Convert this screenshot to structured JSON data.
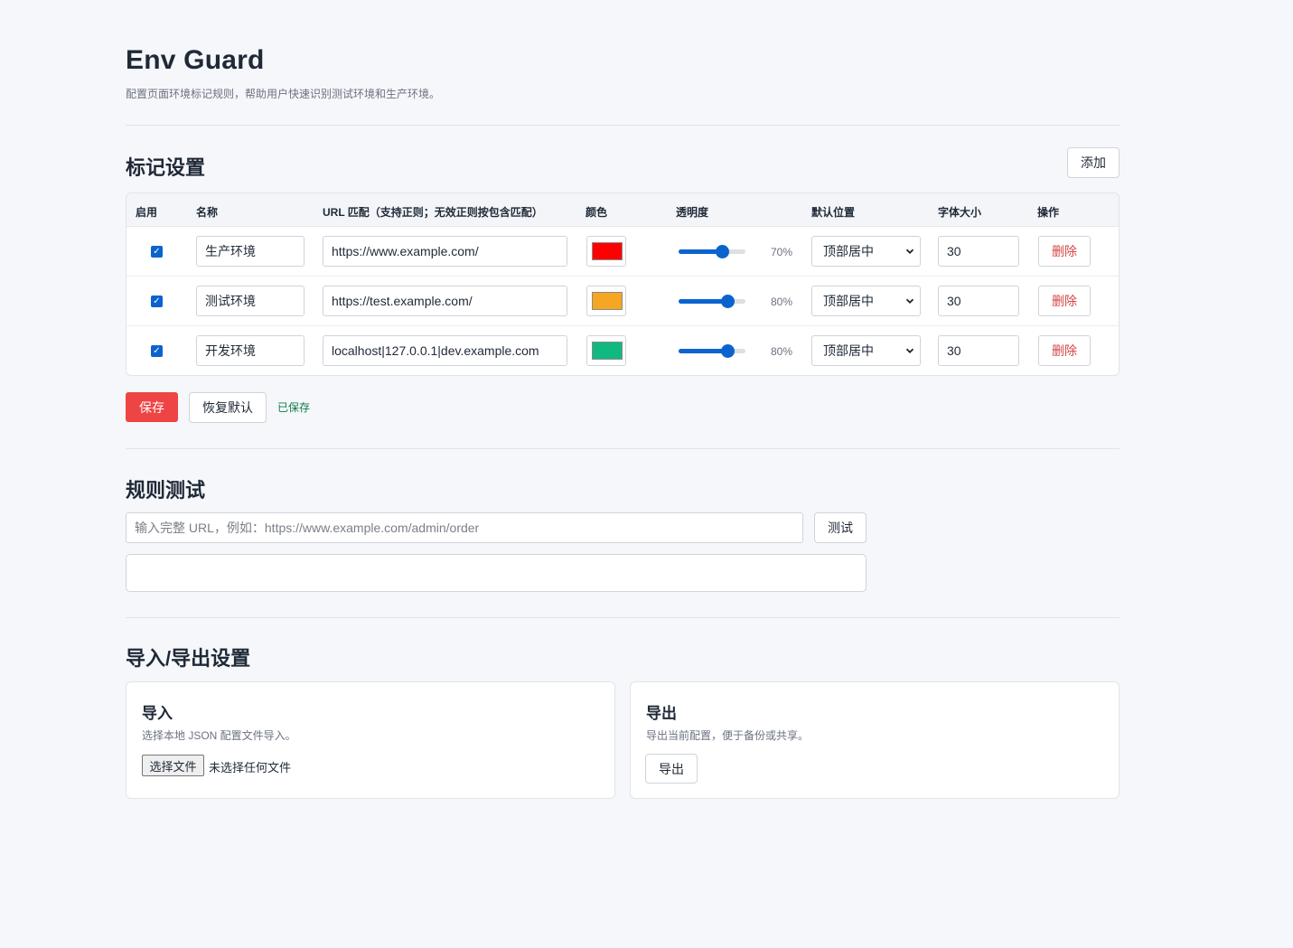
{
  "header": {
    "title": "Env Guard",
    "subtitle": "配置页面环境标记规则，帮助用户快速识别测试环境和生产环境。"
  },
  "markers": {
    "section_title": "标记设置",
    "add_label": "添加",
    "columns": [
      "启用",
      "名称",
      "URL 匹配（支持正则；无效正则按包含匹配）",
      "颜色",
      "透明度",
      "默认位置",
      "字体大小",
      "操作"
    ],
    "rows": [
      {
        "enabled": true,
        "name": "生产环境",
        "url": "https://www.example.com/",
        "color": "#ff0000",
        "opacity": 70,
        "opacity_label": "70%",
        "position": "顶部居中",
        "font_size": "30",
        "delete_label": "删除"
      },
      {
        "enabled": true,
        "name": "测试环境",
        "url": "https://test.example.com/",
        "color": "#f5a623",
        "opacity": 80,
        "opacity_label": "80%",
        "position": "顶部居中",
        "font_size": "30",
        "delete_label": "删除"
      },
      {
        "enabled": true,
        "name": "开发环境",
        "url": "localhost|127.0.0.1|dev.example.com",
        "color": "#10b981",
        "opacity": 80,
        "opacity_label": "80%",
        "position": "顶部居中",
        "font_size": "30",
        "delete_label": "删除"
      }
    ],
    "save_label": "保存",
    "reset_label": "恢复默认",
    "status": "已保存"
  },
  "rule_test": {
    "section_title": "规则测试",
    "placeholder": "输入完整 URL，例如：https://www.example.com/admin/order",
    "test_label": "测试"
  },
  "import_export": {
    "section_title": "导入/导出设置",
    "import": {
      "title": "导入",
      "description": "选择本地 JSON 配置文件导入。",
      "choose_file_label": "选择文件",
      "file_status": "未选择任何文件"
    },
    "export": {
      "title": "导出",
      "description": "导出当前配置，便于备份或共享。",
      "button_label": "导出"
    }
  },
  "colors": {
    "accent": "#0b63ce",
    "danger": "#ef4444",
    "success": "#0f7a4a"
  }
}
